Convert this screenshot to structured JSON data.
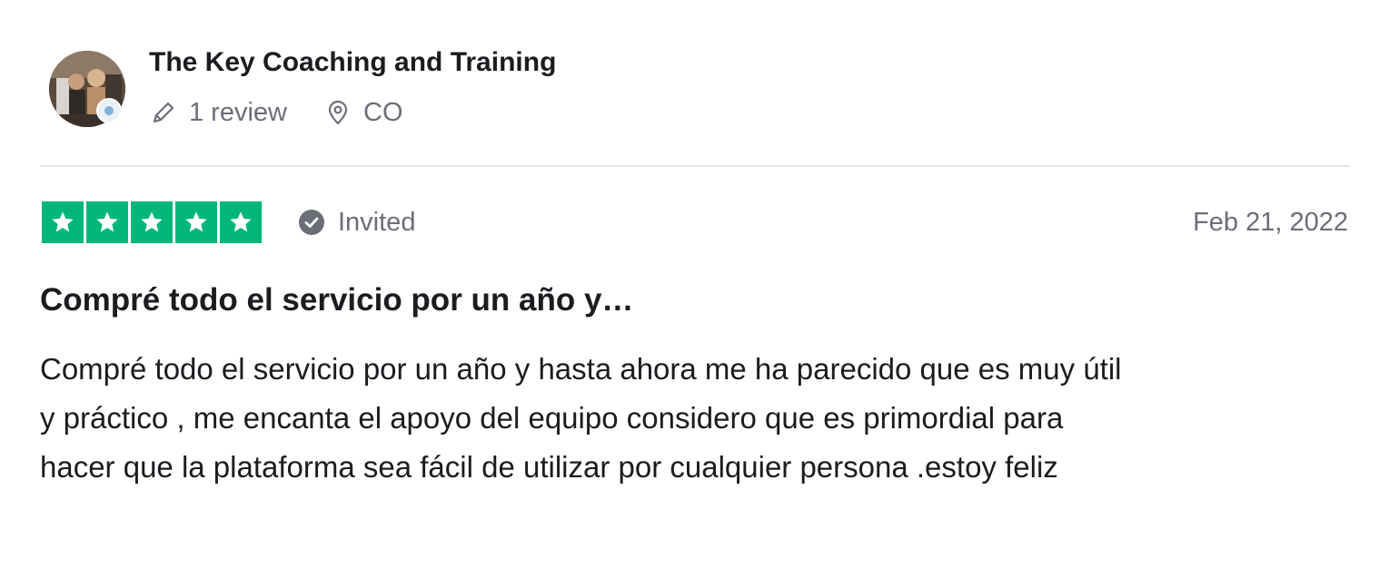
{
  "reviewer": {
    "name": "The Key Coaching and Training",
    "avatar_icon": "profile-photo",
    "review_count": "1 review",
    "review_count_icon": "pencil-icon",
    "location": "CO",
    "location_icon": "location-pin-icon"
  },
  "review": {
    "rating": 5,
    "max_rating": 5,
    "star_color": "#00b67a",
    "invited_label": "Invited",
    "invited_icon": "check-circle-icon",
    "date": "Feb 21, 2022",
    "title": "Compré todo el servicio por un año y…",
    "body_lines": [
      "Compré todo el servicio por un año y hasta ahora me ha parecido que es muy útil",
      "y práctico , me encanta el apoyo del equipo considero que es primordial para",
      "hacer que la plataforma sea fácil de utilizar por cualquier persona .estoy feliz"
    ]
  }
}
